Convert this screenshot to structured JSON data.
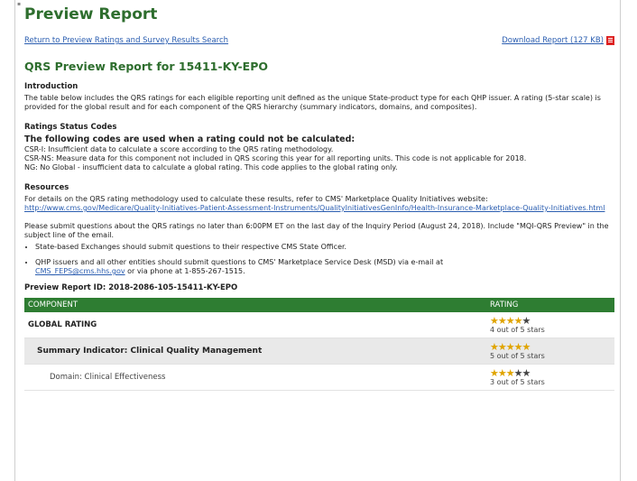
{
  "page": {
    "title": "Preview Report",
    "return_link": "Return to Preview Ratings and Survey Results Search",
    "download_link": "Download Report (127 KB)",
    "report_title": "QRS Preview Report for 15411-KY-EPO"
  },
  "intro": {
    "heading": "Introduction",
    "text": "The table below includes the QRS ratings for each eligible reporting unit defined as the unique State-product type for each QHP issuer. A rating (5-star scale) is provided for the global result and for each component of the QRS hierarchy (summary indicators, domains, and composites)."
  },
  "status_codes": {
    "heading": "Ratings Status Codes",
    "subheading": "The following codes are used when a rating could not be calculated:",
    "codes": [
      "CSR-I: Insufficient data to calculate a score according to the QRS rating methodology.",
      "CSR-NS: Measure data for this component not included in QRS scoring this year for all reporting units. This code is not applicable for 2018.",
      "NG: No Global - insufficient data to calculate a global rating. This code applies to the global rating only."
    ]
  },
  "resources": {
    "heading": "Resources",
    "text": "For details on the QRS rating methodology used to calculate these results, refer to CMS' Marketplace Quality Initiatives website:",
    "url": "http://www.cms.gov/Medicare/Quality-Initiatives-Patient-Assessment-Instruments/QualityInitiativesGenInfo/Health-Insurance-Marketplace-Quality-Initiatives.html",
    "questions": "Please submit questions about the QRS ratings no later than 6:00PM ET on the last day of the Inquiry Period (August 24, 2018). Include \"MQI-QRS Preview\" in the subject line of the email.",
    "bullet1": "State-based Exchanges should submit questions to their respective CMS State Officer.",
    "bullet2_pre": "QHP issuers and all other entities should submit questions to CMS' Marketplace Service Desk (MSD) via e-mail at",
    "bullet2_email": "CMS_FEPS@cms.hhs.gov",
    "bullet2_post": " or via phone at 1-855-267-1515."
  },
  "report_id": "Preview Report ID: 2018-2086-105-15411-KY-EPO",
  "table": {
    "col_component": "COMPONENT",
    "col_rating": "RATING",
    "rows": [
      {
        "component": "GLOBAL RATING",
        "stars": 4,
        "rating_text": "4 out of 5 stars"
      },
      {
        "component": "Summary Indicator: Clinical Quality Management",
        "stars": 5,
        "rating_text": "5 out of 5 stars"
      },
      {
        "component": "Domain: Clinical Effectiveness",
        "stars": 3,
        "rating_text": "3 out of 5 stars"
      }
    ]
  },
  "colors": {
    "accent": "#2e6e2e",
    "header_bg": "#2e7d32",
    "star": "#e0a400",
    "link": "#2a5db0"
  },
  "icons": {
    "download": "pdf-icon",
    "star_filled": "star-filled-icon",
    "star_empty": "star-empty-icon"
  }
}
